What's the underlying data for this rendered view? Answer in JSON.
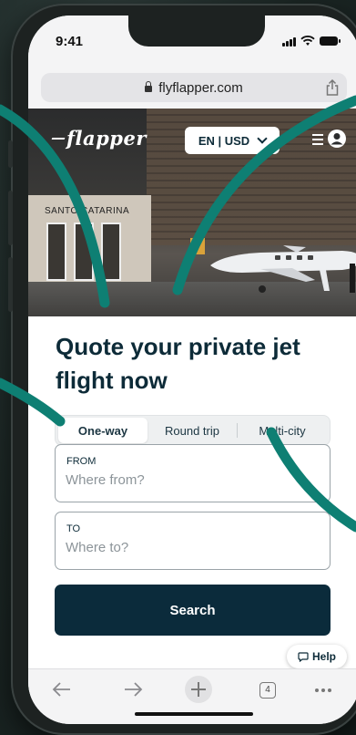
{
  "status_bar": {
    "time": "9:41"
  },
  "browser": {
    "url": "flyflapper.com",
    "tabs_count": "4"
  },
  "hero": {
    "logo_text": "flapper",
    "language_currency": "EN | USD",
    "building_sign": "SANTO CATARINA"
  },
  "headline": "Quote your private jet flight now",
  "trip_tabs": [
    {
      "label": "One-way",
      "active": true
    },
    {
      "label": "Round trip",
      "active": false
    },
    {
      "label": "Multi-city",
      "active": false
    }
  ],
  "from_field": {
    "label": "FROM",
    "placeholder": "Where from?"
  },
  "to_field": {
    "label": "TO",
    "placeholder": "Where to?"
  },
  "search_label": "Search",
  "help_label": "Help",
  "colors": {
    "brand_dark": "#0b2b3b",
    "accent_teal": "#0e7f73"
  }
}
